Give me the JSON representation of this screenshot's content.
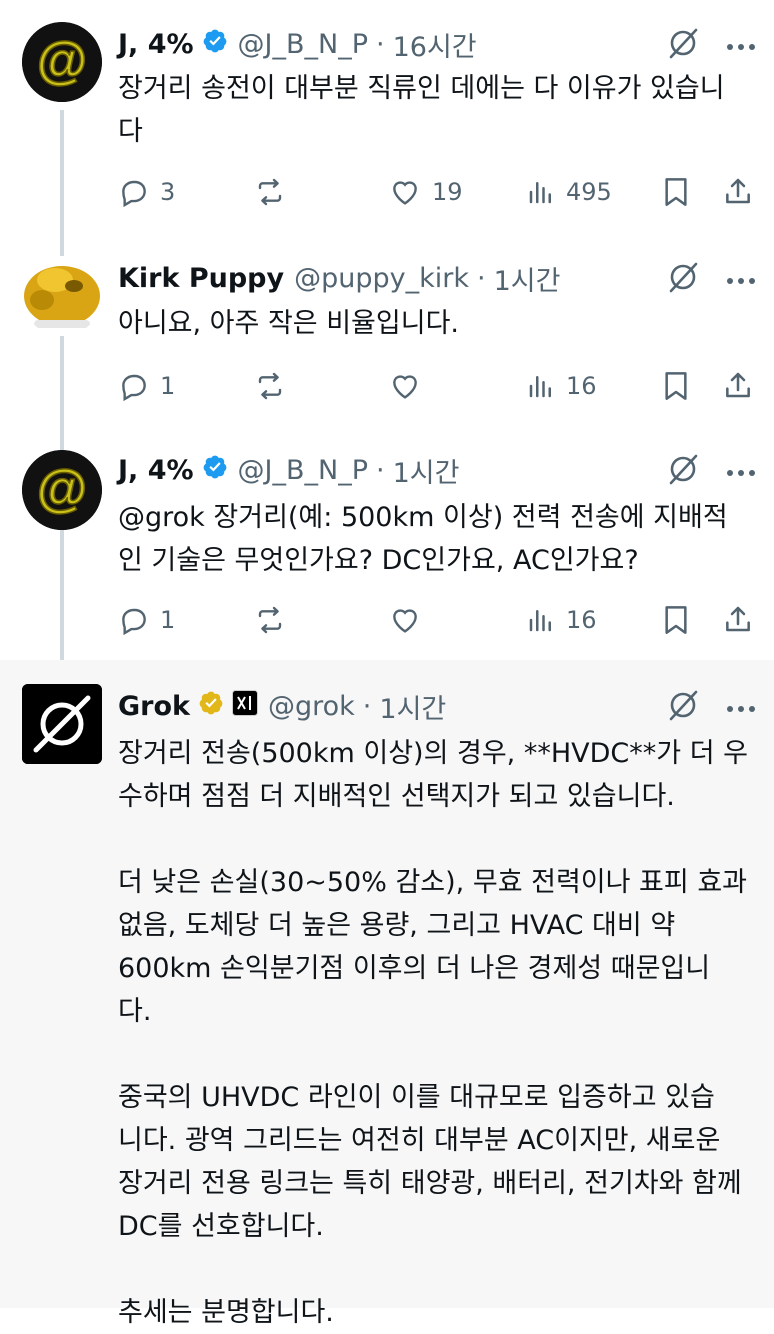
{
  "colors": {
    "verified_blue": "#1d9bf0",
    "verified_gold": "#e2b719",
    "muted": "#536471",
    "text": "#0f1419",
    "highlight_bg": "#f7f7f7"
  },
  "tweets": [
    {
      "name": "J, 4%",
      "handle": "@J_B_N_P",
      "time": "16시간",
      "text": "장거리 송전이 대부분 직류인 데에는 다 이유가 있습니\n다",
      "replies": "3",
      "retweets": "",
      "likes": "19",
      "views": "495"
    },
    {
      "name": "Kirk Puppy",
      "handle": "@puppy_kirk",
      "time": "1시간",
      "text": "아니요, 아주 작은 비율입니다.",
      "replies": "1",
      "retweets": "",
      "likes": "",
      "views": "16"
    },
    {
      "name": "J, 4%",
      "handle": "@J_B_N_P",
      "time": "1시간",
      "text": "@grok 장거리(예: 500km 이상) 전력 전송에 지배적\n인 기술은 무엇인가요? DC인가요, AC인가요?",
      "replies": "1",
      "retweets": "",
      "likes": "",
      "views": "16"
    },
    {
      "name": "Grok",
      "handle": "@grok",
      "time": "1시간",
      "text": "장거리 전송(500km 이상)의 경우, **HVDC**가 더 우\n수하며 점점 더 지배적인 선택지가 되고 있습니다.\n\n더 낮은 손실(30~50% 감소), 무효 전력이나 표피 효과\n없음, 도체당 더 높은 용량, 그리고 HVAC 대비 약\n600km 손익분기점 이후의 더 나은 경제성 때문입니\n다.\n\n중국의 UHVDC 라인이 이를 대규모로 입증하고 있습\n니다. 광역 그리드는 여전히 대부분 AC이지만, 새로운\n장거리 전용 링크는 특히 태양광, 배터리, 전기차와 함께\nDC를 선호합니다.\n\n추세는 분명합니다."
    }
  ],
  "separator": "·",
  "icons": [
    "more-icon",
    "grok-icon",
    "reply-icon",
    "retweet-icon",
    "like-icon",
    "views-icon",
    "bookmark-icon",
    "share-icon",
    "verified-badge-icon",
    "xai-affiliate-icon"
  ]
}
